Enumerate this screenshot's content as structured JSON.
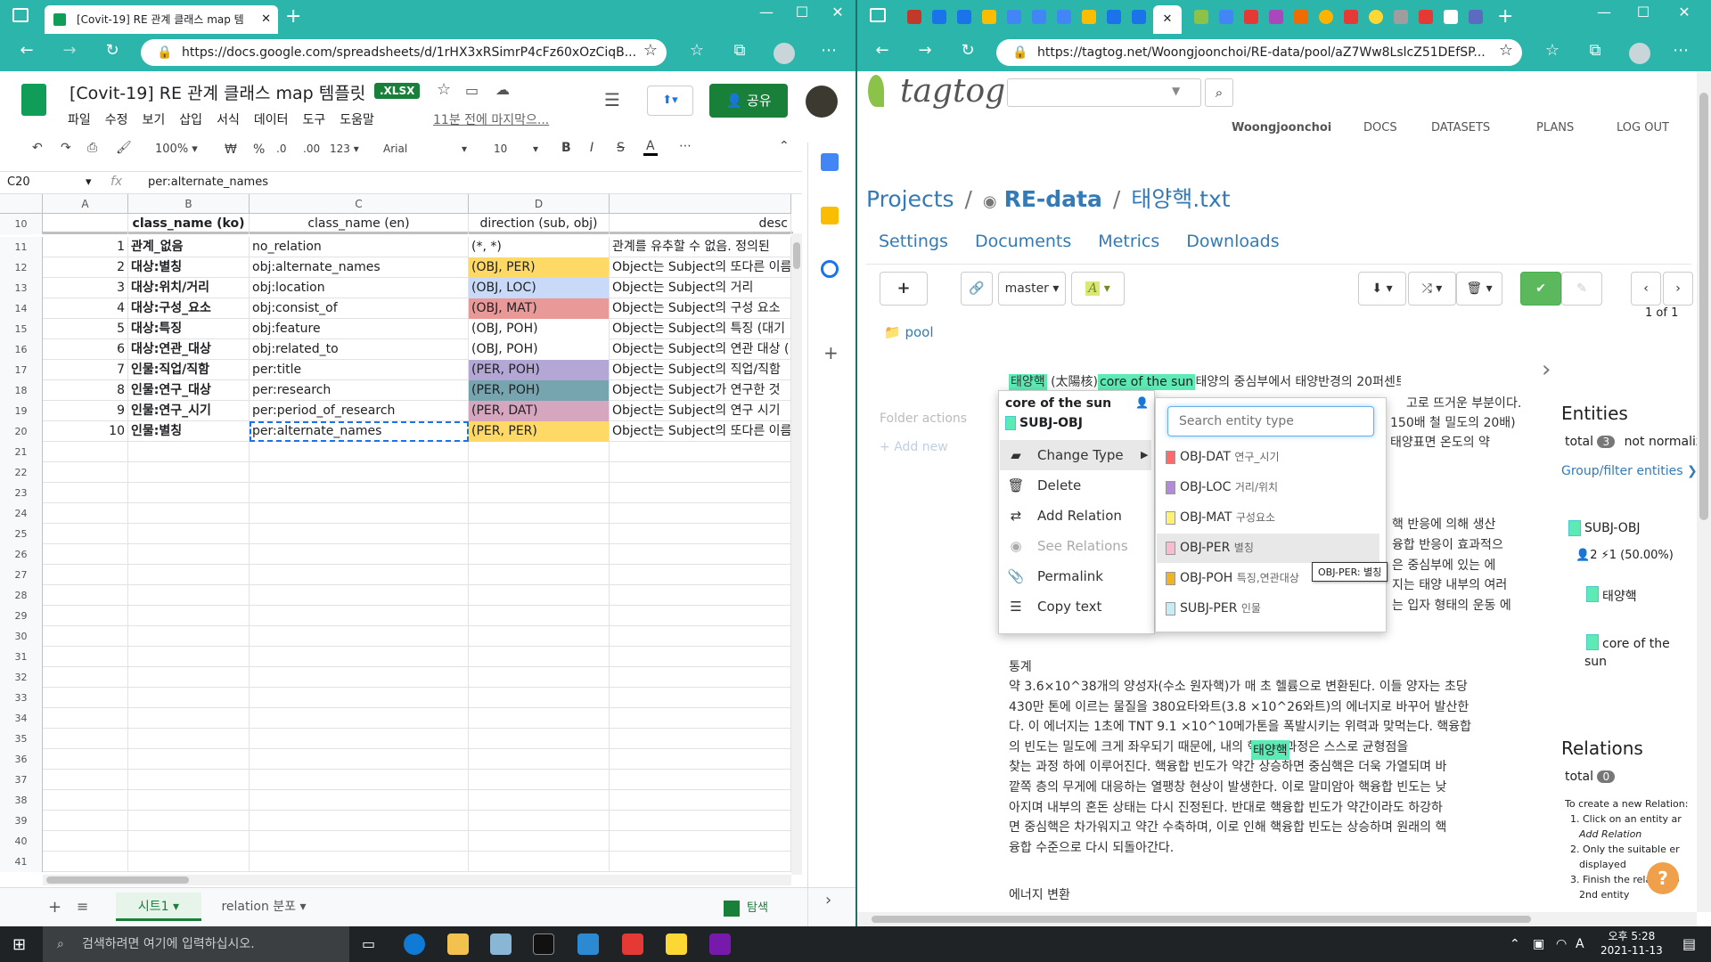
{
  "left_browser": {
    "tab_title": "[Covit-19] RE 관계 클래스 map 템",
    "url": "https://docs.google.com/spreadsheets/d/1rHX3xRSimrP4cFz60xOzCiqB..."
  },
  "right_browser": {
    "url": "https://tagtog.net/Woongjoonchoi/RE-data/pool/aZ7Ww8LslcZ51DEfSP..."
  },
  "sheets": {
    "title": "[Covit-19] RE 관계 클래스 map 템플릿",
    "badge": ".XLSX",
    "menu": [
      "파일",
      "수정",
      "보기",
      "삽입",
      "서식",
      "데이터",
      "도구",
      "도움말"
    ],
    "last_edit": "11분 전에 마지막으...",
    "share_label": "공유",
    "toolbar": {
      "zoom": "100%",
      "currency": "₩",
      "percent": "%",
      "dec1": ".0",
      "dec2": ".00",
      "format": "123",
      "font": "Arial",
      "font_size": "10",
      "bold": "B",
      "italic": "I",
      "strike": "S",
      "text_color": "A"
    },
    "name_box": "C20",
    "formula_fx": "fx",
    "formula": "per:alternate_names",
    "col_headers": [
      "A",
      "B",
      "C",
      "D"
    ],
    "header_row": {
      "num": "10",
      "b": "class_name (ko)",
      "c": "class_name (en)",
      "d": "direction (sub, obj)",
      "e": "desc"
    },
    "rows": [
      {
        "num": "11",
        "a": "1",
        "b": "관계_없음",
        "c": "no_relation",
        "d": "(*, *)",
        "e": "관계를 유추할 수 없음. 정의된",
        "color": "#ffffff"
      },
      {
        "num": "12",
        "a": "2",
        "b": "대상:별칭",
        "c": "obj:alternate_names",
        "d": "(OBJ, PER)",
        "e": "Object는 Subject의 또다른 이름",
        "color": "#ffd966"
      },
      {
        "num": "13",
        "a": "3",
        "b": "대상:위치/거리",
        "c": "obj:location",
        "d": "(OBJ, LOC)",
        "e": "Object는 Subject의 거리",
        "color": "#c9daf8"
      },
      {
        "num": "14",
        "a": "4",
        "b": "대상:구성_요소",
        "c": "obj:consist_of",
        "d": "(OBJ, MAT)",
        "e": "Object는 Subject의 구성 요소",
        "color": "#ea9999"
      },
      {
        "num": "15",
        "a": "5",
        "b": "대상:특징",
        "c": "obj:feature",
        "d": "(OBJ, POH)",
        "e": "Object는 Subject의 특징 (대기",
        "color": "#ffffff"
      },
      {
        "num": "16",
        "a": "6",
        "b": "대상:연관_대상",
        "c": "obj:related_to",
        "d": "(OBJ, POH)",
        "e": "Object는 Subject의 연관 대상 (",
        "color": "#ffffff"
      },
      {
        "num": "17",
        "a": "7",
        "b": "인물:직업/직함",
        "c": "per:title",
        "d": "(PER, POH)",
        "e": "Object는 Subject의 직업/직함",
        "color": "#b4a7d6"
      },
      {
        "num": "18",
        "a": "8",
        "b": "인물:연구_대상",
        "c": "per:research",
        "d": "(PER, POH)",
        "e": "Object는 Subject가 연구한 것",
        "color": "#76a5af"
      },
      {
        "num": "19",
        "a": "9",
        "b": "인물:연구_시기",
        "c": "per:period_of_research",
        "d": "(PER, DAT)",
        "e": "Object는 Subject의 연구 시기",
        "color": "#d5a6bd"
      },
      {
        "num": "20",
        "a": "10",
        "b": "인물:별칭",
        "c": "per:alternate_names",
        "d": "(PER, PER)",
        "e": "Object는 Subject의 또다른 이름",
        "color": "#ffd966"
      }
    ],
    "empty_rows": [
      "21",
      "22",
      "23",
      "24",
      "25",
      "26",
      "27",
      "28",
      "29",
      "30",
      "31",
      "32",
      "33",
      "34",
      "35",
      "36",
      "37",
      "38",
      "39",
      "40",
      "41"
    ],
    "sheet_tabs": [
      "시트1",
      "relation 분포"
    ],
    "explore_label": "탐색"
  },
  "tagtog": {
    "logo": "tagtog",
    "nav": [
      "Woongjoonchoi",
      "DOCS",
      "DATASETS",
      "PLANS",
      "LOG OUT"
    ],
    "breadcrumb": {
      "projects": "Projects",
      "sep": "/",
      "project": "RE-data",
      "file": "태양핵.txt"
    },
    "tabs": [
      "Settings",
      "Documents",
      "Metrics",
      "Downloads"
    ],
    "branch": "master",
    "pagination": "1 of 1",
    "folder": "pool",
    "folder_actions": "Folder actions",
    "add_new": "Add new",
    "popup": {
      "entity_text": "core of the sun",
      "entity_type": "SUBJ-OBJ"
    },
    "menu": [
      "Change Type",
      "Delete",
      "Add Relation",
      "See Relations",
      "Permalink",
      "Copy text"
    ],
    "search_placeholder": "Search entity type",
    "entity_types": [
      {
        "name": "OBJ-DAT",
        "ko": "연구_시기",
        "color": "#ff6b6b"
      },
      {
        "name": "OBJ-LOC",
        "ko": "거리/위치",
        "color": "#b38bd6"
      },
      {
        "name": "OBJ-MAT",
        "ko": "구성요소",
        "color": "#fff176"
      },
      {
        "name": "OBJ-PER",
        "ko": "별칭",
        "color": "#f8bbd0"
      },
      {
        "name": "OBJ-POH",
        "ko": "특징,연관대상",
        "color": "#f0b323"
      },
      {
        "name": "SUBJ-PER",
        "ko": "인물",
        "color": "#c7ecf5"
      }
    ],
    "tooltip": "OBJ-PER: 별칭",
    "doc_lines": [
      "(太陽核), , solar core)은 태양의 중심부에서 태양반경의 20퍼센트",
      "150배 철 밀도의 20배)",
      "고로 뜨거운 부분이다.",
      "태양표면 온도의 약"
    ],
    "doc_partial": [
      "핵 반응에 의해 생산",
      "융합 반응이 효과적으",
      "은 중심부에 있는 에",
      "지는 태양 내부의 여러",
      "는 입자 형태의 운동 에"
    ],
    "highlights": {
      "taeyang": "태양핵",
      "core": "core of the sun"
    },
    "section_title": "통계",
    "paragraph": [
      "약 3.6×10^38개의 양성자(수소 원자핵)가 매 초 헬륨으로 변환된다. 이들 양자는 초당",
      "430만 톤에 이르는 물질을 380요타와트(3.8 ×10^26와트)의 에너지로 바꾸어 발산한",
      "다. 이 에너지는 1초에 TNT 9.1 ×10^10메가톤을 폭발시키는 위력과 맞먹는다. 핵융합",
      "의 빈도는 밀도에 크게 좌우되기 때문에, 내의 핵융합 과정은 스스로 균형점을",
      "찾는 과정 하에 이루어진다. 핵융합 빈도가 약간 상승하면 중심핵은 더욱 가열되며 바",
      "깥쪽 층의 무게에 대응하는 열팽창 현상이 발생한다. 이로 말미암아 핵융합 빈도는 낮",
      "아지며 내부의 혼돈 상태는 다시 진정된다. 반대로 핵융합 빈도가 약간이라도 하강하",
      "면 중심핵은 차가워지고 약간 수축하며, 이로 인해 핵융합 빈도는 상승하며 원래의 핵",
      "융합 수준으로 다시 되돌아간다."
    ],
    "section2": "에너지 변환",
    "entities_title": "Entities",
    "entities_total_label": "total",
    "entities_total": "3",
    "not_normalized": "not normaliz",
    "group_filter": "Group/filter entities",
    "entity_class": "SUBJ-OBJ",
    "entity_stats": "2  ⚡1 (50.00%)",
    "entity_items": [
      "태양핵",
      "core of the sun"
    ],
    "relations_title": "Relations",
    "relations_total": "0",
    "relations_help": [
      "To create a new Relation:",
      "1. Click on an entity ar",
      "Add Relation",
      "2. Only the suitable er",
      "displayed",
      "3. Finish the relation b",
      "2nd entity"
    ]
  },
  "taskbar": {
    "search": "검색하려면 여기에 입력하십시오.",
    "time": "오후 5:28",
    "date": "2021-11-13",
    "lang": "A"
  }
}
